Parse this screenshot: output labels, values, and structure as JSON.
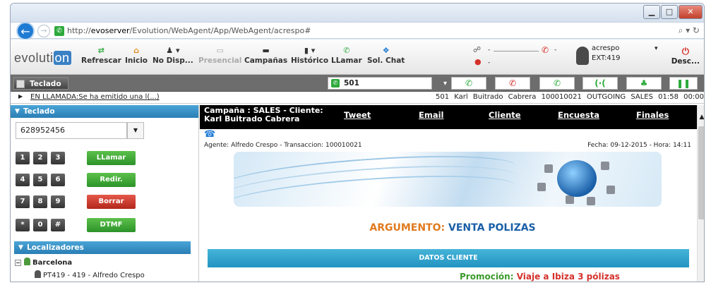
{
  "browser": {
    "url_prefix": "http://",
    "url_host": "evoserver",
    "url_path": "/Evolution/WebAgent/App/WebAgent/acrespo#",
    "search_icon": "⌕ ▾ ↻"
  },
  "toolbar": {
    "logo": "evoluti",
    "logo_tail": "on",
    "buttons": [
      {
        "label": "Refrescar",
        "icon": "⇄"
      },
      {
        "label": "Inicio",
        "icon": "⌂"
      },
      {
        "label": "No Disp...",
        "icon": "♟ ▾"
      },
      {
        "label": "Presencial",
        "icon": "▭"
      },
      {
        "label": "Campañas",
        "icon": "▬"
      },
      {
        "label": "Histórico",
        "icon": "▮ ▾"
      },
      {
        "label": "LLamar",
        "icon": "✆"
      },
      {
        "label": "Sol. Chat",
        "icon": "❖"
      }
    ],
    "status1": "-",
    "status2": "-",
    "phone_status": "-",
    "user": "acrespo",
    "ext": "EXT:419",
    "disconnect": "Desc..."
  },
  "row2": {
    "teclado_tab": "Teclado",
    "line": "501"
  },
  "statusrow": {
    "left": "EN LLAMADA:Se ha emitido una l(...)",
    "ext": "501",
    "name": "Karl Buitrado Cabrera",
    "id": "100010021",
    "dir": "OUTGOING",
    "campaign": "SALES",
    "t1": "01:58",
    "t2": "00:00"
  },
  "left": {
    "teclado_header": "Teclado",
    "number": "628952456",
    "keys": [
      "1",
      "2",
      "3",
      "4",
      "5",
      "6",
      "7",
      "8",
      "9",
      "*",
      "0",
      "#"
    ],
    "btn_call": "LLamar",
    "btn_redir": "Redir.",
    "btn_delete": "Borrar",
    "btn_dtmf": "DTMF",
    "loc_header": "Localizadores",
    "tree_root": "Barcelona",
    "tree_child": "PT419 - 419 - Alfredo Crespo"
  },
  "content": {
    "campaign_line1": "Campaña : SALES - Cliente:",
    "campaign_line2": "Karl Buitrado Cabrera",
    "links": [
      "Tweet",
      "Email",
      "Cliente",
      "Encuesta",
      "Finales"
    ],
    "agent": "Agente: Alfredo Crespo  - Transaccion: 100010021",
    "fecha": "Fecha: 09-12-2015 - Hora: 14:11",
    "argumento_label": "ARGUMENTO:",
    "argumento_value": "VENTA POLIZAS",
    "datos_title": "DATOS CLIENTE",
    "promo_label": "Promoción:",
    "promo_value": "Viaje a Ibiza 3 pólizas"
  }
}
